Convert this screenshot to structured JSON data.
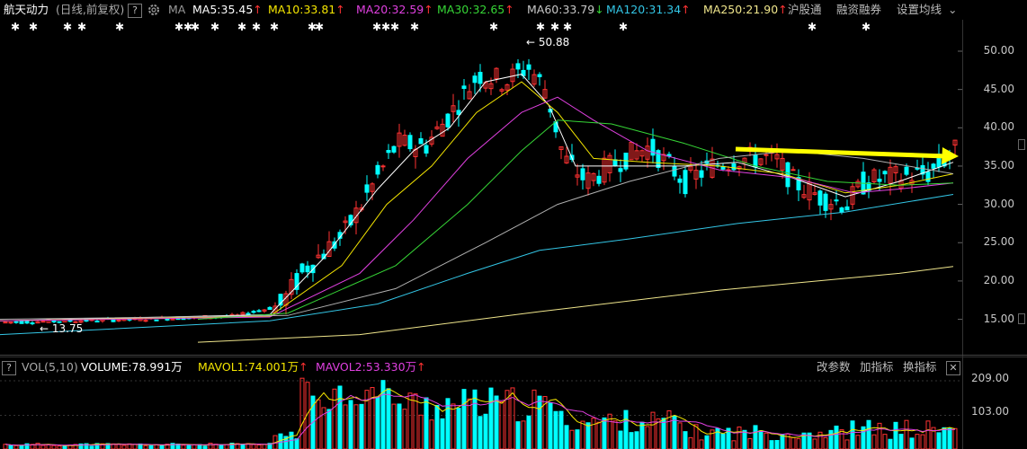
{
  "header": {
    "stock_name": "航天动力",
    "period_label": "(日线,前复权)",
    "help_icon": "?",
    "settings_icon": "gear-icon",
    "ma_label": "MA",
    "indicators": [
      {
        "text": "MA5:35.45",
        "arrow": "↑",
        "color": "#ffffff"
      },
      {
        "text": "MA10:33.81",
        "arrow": "↑",
        "color": "#f5e600"
      },
      {
        "text": "MA20:32.59",
        "arrow": "↑",
        "color": "#e040e0"
      },
      {
        "text": "MA30:32.65",
        "arrow": "↑",
        "color": "#36d636"
      },
      {
        "text": "MA60:33.79",
        "arrow": "↓",
        "color": "#c8c8c8"
      },
      {
        "text": "MA120:31.34",
        "arrow": "↑",
        "color": "#33c6e6"
      },
      {
        "text": "MA250:21.90",
        "arrow": "↑",
        "color": "#f0e68c"
      }
    ],
    "menu": [
      "沪股通",
      "融资融券",
      "设置均线"
    ]
  },
  "star_marker": "✱",
  "price_axis": [
    "50.00",
    "45.00",
    "40.00",
    "35.00",
    "30.00",
    "25.00",
    "20.00",
    "15.00"
  ],
  "annotations": {
    "high": "50.88",
    "low": "13.75"
  },
  "volume_bar": {
    "indicator": "VOL(5,10)",
    "volume": "VOLUME:78.991万",
    "mavol1": "MAVOL1:74.001万",
    "mavol2": "MAVOL2:53.330万",
    "arrow": "↑",
    "buttons": [
      "改参数",
      "加指标",
      "换指标"
    ],
    "close": "✕"
  },
  "volume_axis": [
    "209.00",
    "103.00"
  ],
  "colors": {
    "up": "#ff3232",
    "down": "#00ffff",
    "arrow": "#ffff00",
    "grid": "#333333"
  }
}
